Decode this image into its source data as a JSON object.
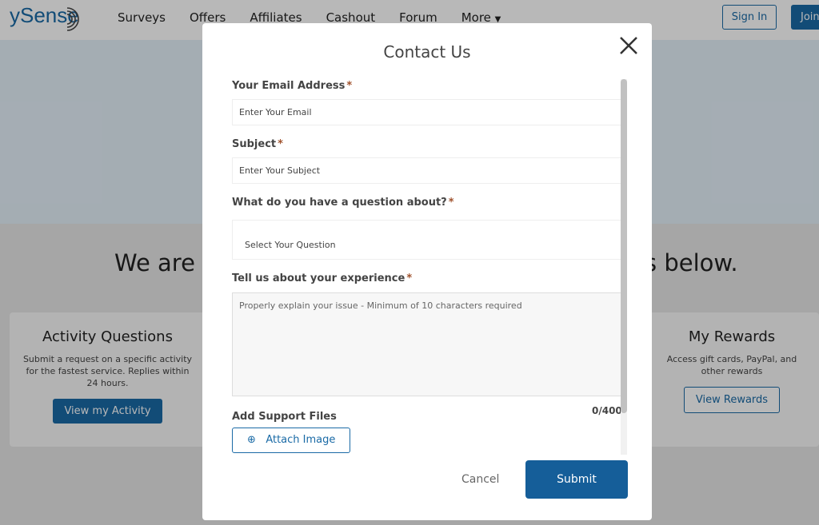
{
  "header": {
    "logo": "ySense",
    "nav": [
      "Surveys",
      "Offers",
      "Affiliates",
      "Cashout",
      "Forum",
      "More"
    ],
    "sign_in": "Sign In",
    "join": "Join"
  },
  "background": {
    "headline_left": "We are h",
    "headline_right": "s below.",
    "cards": [
      {
        "title": "Activity Questions",
        "text": "Submit a request on a specific activity for the fastest service. Replies within 24 hours.",
        "button": "View my Activity"
      },
      {
        "title": "My Rewards",
        "text": "Access gift cards, PayPal, and other rewards",
        "button": "View Rewards"
      }
    ]
  },
  "modal": {
    "title": "Contact Us",
    "required_mark": "*",
    "email": {
      "label": "Your Email Address",
      "placeholder": "Enter Your Email"
    },
    "subject": {
      "label": "Subject",
      "placeholder": "Enter Your Subject"
    },
    "question": {
      "label": "What do you have a question about?",
      "selected": "Select Your Question"
    },
    "experience": {
      "label": "Tell us about your experience",
      "placeholder": "Properly explain your issue - Minimum of 10 characters required",
      "counter": "0/400"
    },
    "files": {
      "label": "Add Support Files",
      "attach": "Attach Image"
    },
    "cancel": "Cancel",
    "submit": "Submit"
  },
  "colors": {
    "brand": "#1a6aa6",
    "submit": "#155e99",
    "required": "#a0522d"
  }
}
